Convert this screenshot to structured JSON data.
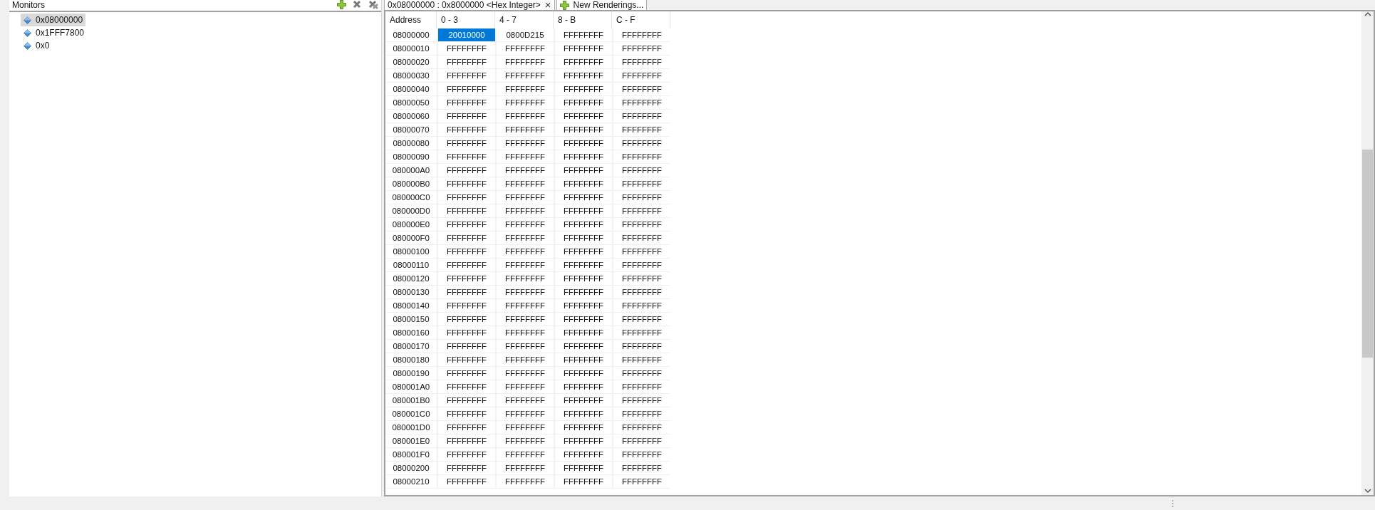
{
  "monitors": {
    "title": "Monitors",
    "items": [
      {
        "label": "0x08000000",
        "selected": true
      },
      {
        "label": "0x1FFF7800",
        "selected": false
      },
      {
        "label": "0x0",
        "selected": false
      }
    ]
  },
  "tabs": [
    {
      "kind": "rendering",
      "label": "0x08000000 : 0x8000000 <Hex Integer>",
      "close": "×"
    },
    {
      "kind": "new",
      "label": "New Renderings..."
    }
  ],
  "table": {
    "columns": [
      "Address",
      "0 - 3",
      "4 - 7",
      "8 - B",
      "C - F"
    ],
    "rows": [
      {
        "cells": [
          {
            "value": "08000000",
            "selected": false
          },
          {
            "value": "20010000",
            "selected": true
          },
          {
            "value": "0800D215",
            "selected": false
          },
          {
            "value": "FFFFFFFF",
            "selected": false
          },
          {
            "value": "FFFFFFFF",
            "selected": false
          }
        ]
      },
      {
        "cells": [
          {
            "value": "08000010",
            "selected": false
          },
          {
            "value": "FFFFFFFF",
            "selected": false
          },
          {
            "value": "FFFFFFFF",
            "selected": false
          },
          {
            "value": "FFFFFFFF",
            "selected": false
          },
          {
            "value": "FFFFFFFF",
            "selected": false
          }
        ]
      },
      {
        "cells": [
          {
            "value": "08000020",
            "selected": false
          },
          {
            "value": "FFFFFFFF",
            "selected": false
          },
          {
            "value": "FFFFFFFF",
            "selected": false
          },
          {
            "value": "FFFFFFFF",
            "selected": false
          },
          {
            "value": "FFFFFFFF",
            "selected": false
          }
        ]
      },
      {
        "cells": [
          {
            "value": "08000030",
            "selected": false
          },
          {
            "value": "FFFFFFFF",
            "selected": false
          },
          {
            "value": "FFFFFFFF",
            "selected": false
          },
          {
            "value": "FFFFFFFF",
            "selected": false
          },
          {
            "value": "FFFFFFFF",
            "selected": false
          }
        ]
      },
      {
        "cells": [
          {
            "value": "08000040",
            "selected": false
          },
          {
            "value": "FFFFFFFF",
            "selected": false
          },
          {
            "value": "FFFFFFFF",
            "selected": false
          },
          {
            "value": "FFFFFFFF",
            "selected": false
          },
          {
            "value": "FFFFFFFF",
            "selected": false
          }
        ]
      },
      {
        "cells": [
          {
            "value": "08000050",
            "selected": false
          },
          {
            "value": "FFFFFFFF",
            "selected": false
          },
          {
            "value": "FFFFFFFF",
            "selected": false
          },
          {
            "value": "FFFFFFFF",
            "selected": false
          },
          {
            "value": "FFFFFFFF",
            "selected": false
          }
        ]
      },
      {
        "cells": [
          {
            "value": "08000060",
            "selected": false
          },
          {
            "value": "FFFFFFFF",
            "selected": false
          },
          {
            "value": "FFFFFFFF",
            "selected": false
          },
          {
            "value": "FFFFFFFF",
            "selected": false
          },
          {
            "value": "FFFFFFFF",
            "selected": false
          }
        ]
      },
      {
        "cells": [
          {
            "value": "08000070",
            "selected": false
          },
          {
            "value": "FFFFFFFF",
            "selected": false
          },
          {
            "value": "FFFFFFFF",
            "selected": false
          },
          {
            "value": "FFFFFFFF",
            "selected": false
          },
          {
            "value": "FFFFFFFF",
            "selected": false
          }
        ]
      },
      {
        "cells": [
          {
            "value": "08000080",
            "selected": false
          },
          {
            "value": "FFFFFFFF",
            "selected": false
          },
          {
            "value": "FFFFFFFF",
            "selected": false
          },
          {
            "value": "FFFFFFFF",
            "selected": false
          },
          {
            "value": "FFFFFFFF",
            "selected": false
          }
        ]
      },
      {
        "cells": [
          {
            "value": "08000090",
            "selected": false
          },
          {
            "value": "FFFFFFFF",
            "selected": false
          },
          {
            "value": "FFFFFFFF",
            "selected": false
          },
          {
            "value": "FFFFFFFF",
            "selected": false
          },
          {
            "value": "FFFFFFFF",
            "selected": false
          }
        ]
      },
      {
        "cells": [
          {
            "value": "080000A0",
            "selected": false
          },
          {
            "value": "FFFFFFFF",
            "selected": false
          },
          {
            "value": "FFFFFFFF",
            "selected": false
          },
          {
            "value": "FFFFFFFF",
            "selected": false
          },
          {
            "value": "FFFFFFFF",
            "selected": false
          }
        ]
      },
      {
        "cells": [
          {
            "value": "080000B0",
            "selected": false
          },
          {
            "value": "FFFFFFFF",
            "selected": false
          },
          {
            "value": "FFFFFFFF",
            "selected": false
          },
          {
            "value": "FFFFFFFF",
            "selected": false
          },
          {
            "value": "FFFFFFFF",
            "selected": false
          }
        ]
      },
      {
        "cells": [
          {
            "value": "080000C0",
            "selected": false
          },
          {
            "value": "FFFFFFFF",
            "selected": false
          },
          {
            "value": "FFFFFFFF",
            "selected": false
          },
          {
            "value": "FFFFFFFF",
            "selected": false
          },
          {
            "value": "FFFFFFFF",
            "selected": false
          }
        ]
      },
      {
        "cells": [
          {
            "value": "080000D0",
            "selected": false
          },
          {
            "value": "FFFFFFFF",
            "selected": false
          },
          {
            "value": "FFFFFFFF",
            "selected": false
          },
          {
            "value": "FFFFFFFF",
            "selected": false
          },
          {
            "value": "FFFFFFFF",
            "selected": false
          }
        ]
      },
      {
        "cells": [
          {
            "value": "080000E0",
            "selected": false
          },
          {
            "value": "FFFFFFFF",
            "selected": false
          },
          {
            "value": "FFFFFFFF",
            "selected": false
          },
          {
            "value": "FFFFFFFF",
            "selected": false
          },
          {
            "value": "FFFFFFFF",
            "selected": false
          }
        ]
      },
      {
        "cells": [
          {
            "value": "080000F0",
            "selected": false
          },
          {
            "value": "FFFFFFFF",
            "selected": false
          },
          {
            "value": "FFFFFFFF",
            "selected": false
          },
          {
            "value": "FFFFFFFF",
            "selected": false
          },
          {
            "value": "FFFFFFFF",
            "selected": false
          }
        ]
      },
      {
        "cells": [
          {
            "value": "08000100",
            "selected": false
          },
          {
            "value": "FFFFFFFF",
            "selected": false
          },
          {
            "value": "FFFFFFFF",
            "selected": false
          },
          {
            "value": "FFFFFFFF",
            "selected": false
          },
          {
            "value": "FFFFFFFF",
            "selected": false
          }
        ]
      },
      {
        "cells": [
          {
            "value": "08000110",
            "selected": false
          },
          {
            "value": "FFFFFFFF",
            "selected": false
          },
          {
            "value": "FFFFFFFF",
            "selected": false
          },
          {
            "value": "FFFFFFFF",
            "selected": false
          },
          {
            "value": "FFFFFFFF",
            "selected": false
          }
        ]
      },
      {
        "cells": [
          {
            "value": "08000120",
            "selected": false
          },
          {
            "value": "FFFFFFFF",
            "selected": false
          },
          {
            "value": "FFFFFFFF",
            "selected": false
          },
          {
            "value": "FFFFFFFF",
            "selected": false
          },
          {
            "value": "FFFFFFFF",
            "selected": false
          }
        ]
      },
      {
        "cells": [
          {
            "value": "08000130",
            "selected": false
          },
          {
            "value": "FFFFFFFF",
            "selected": false
          },
          {
            "value": "FFFFFFFF",
            "selected": false
          },
          {
            "value": "FFFFFFFF",
            "selected": false
          },
          {
            "value": "FFFFFFFF",
            "selected": false
          }
        ]
      },
      {
        "cells": [
          {
            "value": "08000140",
            "selected": false
          },
          {
            "value": "FFFFFFFF",
            "selected": false
          },
          {
            "value": "FFFFFFFF",
            "selected": false
          },
          {
            "value": "FFFFFFFF",
            "selected": false
          },
          {
            "value": "FFFFFFFF",
            "selected": false
          }
        ]
      },
      {
        "cells": [
          {
            "value": "08000150",
            "selected": false
          },
          {
            "value": "FFFFFFFF",
            "selected": false
          },
          {
            "value": "FFFFFFFF",
            "selected": false
          },
          {
            "value": "FFFFFFFF",
            "selected": false
          },
          {
            "value": "FFFFFFFF",
            "selected": false
          }
        ]
      },
      {
        "cells": [
          {
            "value": "08000160",
            "selected": false
          },
          {
            "value": "FFFFFFFF",
            "selected": false
          },
          {
            "value": "FFFFFFFF",
            "selected": false
          },
          {
            "value": "FFFFFFFF",
            "selected": false
          },
          {
            "value": "FFFFFFFF",
            "selected": false
          }
        ]
      },
      {
        "cells": [
          {
            "value": "08000170",
            "selected": false
          },
          {
            "value": "FFFFFFFF",
            "selected": false
          },
          {
            "value": "FFFFFFFF",
            "selected": false
          },
          {
            "value": "FFFFFFFF",
            "selected": false
          },
          {
            "value": "FFFFFFFF",
            "selected": false
          }
        ]
      },
      {
        "cells": [
          {
            "value": "08000180",
            "selected": false
          },
          {
            "value": "FFFFFFFF",
            "selected": false
          },
          {
            "value": "FFFFFFFF",
            "selected": false
          },
          {
            "value": "FFFFFFFF",
            "selected": false
          },
          {
            "value": "FFFFFFFF",
            "selected": false
          }
        ]
      },
      {
        "cells": [
          {
            "value": "08000190",
            "selected": false
          },
          {
            "value": "FFFFFFFF",
            "selected": false
          },
          {
            "value": "FFFFFFFF",
            "selected": false
          },
          {
            "value": "FFFFFFFF",
            "selected": false
          },
          {
            "value": "FFFFFFFF",
            "selected": false
          }
        ]
      },
      {
        "cells": [
          {
            "value": "080001A0",
            "selected": false
          },
          {
            "value": "FFFFFFFF",
            "selected": false
          },
          {
            "value": "FFFFFFFF",
            "selected": false
          },
          {
            "value": "FFFFFFFF",
            "selected": false
          },
          {
            "value": "FFFFFFFF",
            "selected": false
          }
        ]
      },
      {
        "cells": [
          {
            "value": "080001B0",
            "selected": false
          },
          {
            "value": "FFFFFFFF",
            "selected": false
          },
          {
            "value": "FFFFFFFF",
            "selected": false
          },
          {
            "value": "FFFFFFFF",
            "selected": false
          },
          {
            "value": "FFFFFFFF",
            "selected": false
          }
        ]
      },
      {
        "cells": [
          {
            "value": "080001C0",
            "selected": false
          },
          {
            "value": "FFFFFFFF",
            "selected": false
          },
          {
            "value": "FFFFFFFF",
            "selected": false
          },
          {
            "value": "FFFFFFFF",
            "selected": false
          },
          {
            "value": "FFFFFFFF",
            "selected": false
          }
        ]
      },
      {
        "cells": [
          {
            "value": "080001D0",
            "selected": false
          },
          {
            "value": "FFFFFFFF",
            "selected": false
          },
          {
            "value": "FFFFFFFF",
            "selected": false
          },
          {
            "value": "FFFFFFFF",
            "selected": false
          },
          {
            "value": "FFFFFFFF",
            "selected": false
          }
        ]
      },
      {
        "cells": [
          {
            "value": "080001E0",
            "selected": false
          },
          {
            "value": "FFFFFFFF",
            "selected": false
          },
          {
            "value": "FFFFFFFF",
            "selected": false
          },
          {
            "value": "FFFFFFFF",
            "selected": false
          },
          {
            "value": "FFFFFFFF",
            "selected": false
          }
        ]
      },
      {
        "cells": [
          {
            "value": "080001F0",
            "selected": false
          },
          {
            "value": "FFFFFFFF",
            "selected": false
          },
          {
            "value": "FFFFFFFF",
            "selected": false
          },
          {
            "value": "FFFFFFFF",
            "selected": false
          },
          {
            "value": "FFFFFFFF",
            "selected": false
          }
        ]
      },
      {
        "cells": [
          {
            "value": "08000200",
            "selected": false
          },
          {
            "value": "FFFFFFFF",
            "selected": false
          },
          {
            "value": "FFFFFFFF",
            "selected": false
          },
          {
            "value": "FFFFFFFF",
            "selected": false
          },
          {
            "value": "FFFFFFFF",
            "selected": false
          }
        ]
      },
      {
        "cells": [
          {
            "value": "08000210",
            "selected": false
          },
          {
            "value": "FFFFFFFF",
            "selected": false
          },
          {
            "value": "FFFFFFFF",
            "selected": false
          },
          {
            "value": "FFFFFFFF",
            "selected": false
          },
          {
            "value": "FFFFFFFF",
            "selected": false
          }
        ]
      }
    ]
  }
}
